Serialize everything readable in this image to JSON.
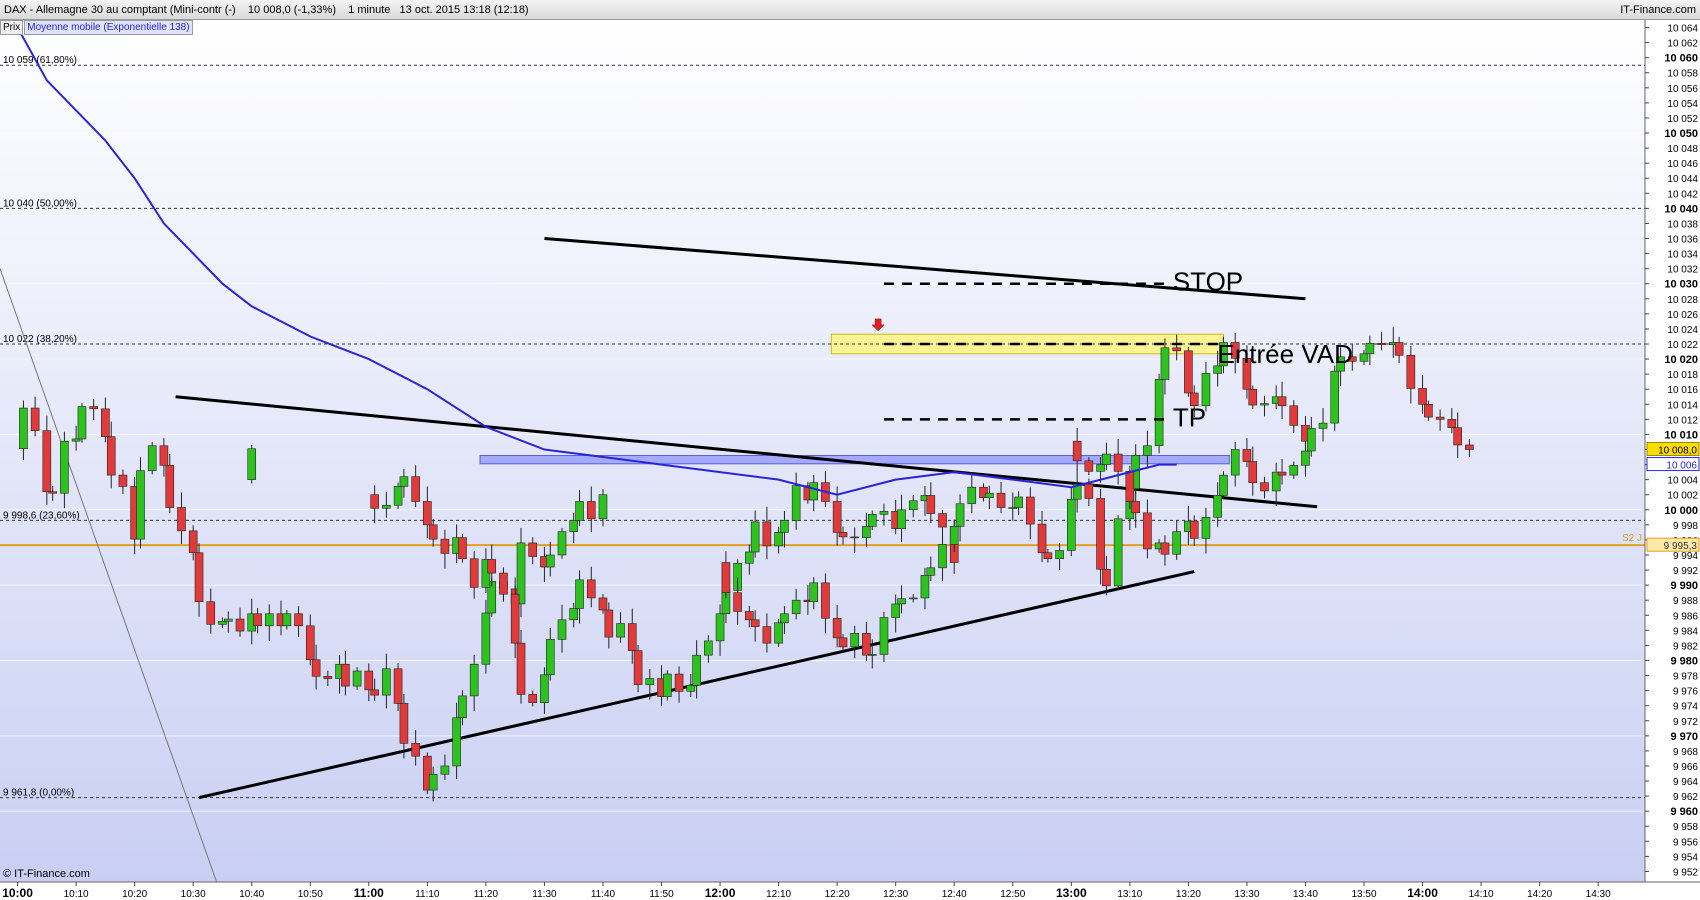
{
  "header": {
    "title": "DAX - Allemagne 30 au comptant (Mini-contr (-)    10 008,0 (-1,33%)    1 minute   13 oct. 2015 13:18 (12:18)",
    "brand": "IT-Finance.com"
  },
  "legend": {
    "price": "Prix",
    "ma": "Moyenne mobile (Exponentielle 138)"
  },
  "watermark": "© IT-Finance.com",
  "colors": {
    "up": "#2ec21f",
    "down": "#e03a3a",
    "ma": "#2b24d6",
    "fib": "#333333",
    "s2": "#e0a020",
    "zone_yellow": "#fff48a",
    "zone_blue": "#9fa4ff"
  },
  "chart_data": {
    "type": "candlestick",
    "ylim": [
      9950.6,
      10065
    ],
    "y_ticks_bold": [
      "10 060",
      "10 050",
      "10 040",
      "10 030",
      "10 020",
      "10 010",
      "10 000",
      "9 990",
      "9 980",
      "9 970",
      "9 960"
    ],
    "y_ticks_minor": [
      "10 064",
      "10 062",
      "10 058",
      "10 056",
      "10 054",
      "10 052",
      "10 048",
      "10 046",
      "10 044",
      "10 042",
      "10 038",
      "10 036",
      "10 034",
      "10 032",
      "10 028",
      "10 026",
      "10 024",
      "10 022",
      "10 018",
      "10 016",
      "10 014",
      "10 012",
      "10 008",
      "10 006",
      "10 004",
      "10 002",
      "9 998",
      "9 996",
      "9 994",
      "9 992",
      "9 988",
      "9 986",
      "9 984",
      "9 982",
      "9 978",
      "9 976",
      "9 974",
      "9 972",
      "9 968",
      "9 966",
      "9 964",
      "9 962",
      "9 958",
      "9 956",
      "9 954",
      "9 952"
    ],
    "x_range": [
      "09:57",
      "14:38"
    ],
    "x_ticks": [
      {
        "t": "10:00",
        "bold": true
      },
      {
        "t": "10:10"
      },
      {
        "t": "10:20"
      },
      {
        "t": "10:30"
      },
      {
        "t": "10:40"
      },
      {
        "t": "10:50"
      },
      {
        "t": "11:00",
        "bold": true
      },
      {
        "t": "11:10"
      },
      {
        "t": "11:20"
      },
      {
        "t": "11:30"
      },
      {
        "t": "11:40"
      },
      {
        "t": "11:50"
      },
      {
        "t": "12:00",
        "bold": true
      },
      {
        "t": "12:10"
      },
      {
        "t": "12:20"
      },
      {
        "t": "12:30"
      },
      {
        "t": "12:40"
      },
      {
        "t": "12:50"
      },
      {
        "t": "13:00",
        "bold": true
      },
      {
        "t": "13:10"
      },
      {
        "t": "13:20"
      },
      {
        "t": "13:30"
      },
      {
        "t": "13:40"
      },
      {
        "t": "13:50"
      },
      {
        "t": "14:00",
        "bold": true
      },
      {
        "t": "14:10"
      },
      {
        "t": "14:20"
      },
      {
        "t": "14:30"
      }
    ],
    "fib_levels": [
      {
        "value": 10059,
        "label": "10 059 (61,80%)"
      },
      {
        "value": 10040,
        "label": "10 040 (50,00%)"
      },
      {
        "value": 10022,
        "label": "10 022 (38,20%)"
      },
      {
        "value": 9998.6,
        "label": "9 998,6 (23,60%)"
      },
      {
        "value": 9961.8,
        "label": "9 961,8 (0,00%)"
      }
    ],
    "s2": {
      "value": 9995.3,
      "label": "S2 J",
      "price_label": "9 995,3"
    },
    "last_price": {
      "value": 10008,
      "label": "10 008,0"
    },
    "ma_last": {
      "value": 10006,
      "label": "10 006"
    },
    "annotations": [
      {
        "text": "STOP",
        "value": 10030,
        "t_start": "12:28",
        "t_end": "13:17"
      },
      {
        "text": "Entrée VAD",
        "value": 10022,
        "t_start": "12:28",
        "t_end": "13:26"
      },
      {
        "text": "TP",
        "value": 10012,
        "t_start": "12:28",
        "t_end": "13:17"
      }
    ],
    "zones": [
      {
        "color": "yellow",
        "t_start": "12:19",
        "t_end": "13:26",
        "y_low": 10020.7,
        "y_high": 10023.3
      },
      {
        "color": "blue",
        "t_start": "11:19",
        "t_end": "13:27",
        "y_low": 10006.1,
        "y_high": 10007.2
      }
    ],
    "trendlines": [
      {
        "t1": "11:30",
        "v1": 10036,
        "t2": "13:40",
        "v2": 10028,
        "width": 3
      },
      {
        "t1": "10:27",
        "v1": 10015,
        "t2": "13:42",
        "v2": 10000.4,
        "width": 3
      },
      {
        "t1": "10:31",
        "v1": 9961.8,
        "t2": "13:21",
        "v2": 9991.8,
        "width": 3
      },
      {
        "t1": "09:57",
        "v1": 10032,
        "t2": "10:34",
        "v2": 9950.6,
        "width": 1
      }
    ],
    "signal_arrow": {
      "t": "12:27",
      "value": 10024
    },
    "ma_points": [
      [
        "10:00",
        10064
      ],
      [
        "10:05",
        10057
      ],
      [
        "10:10",
        10053
      ],
      [
        "10:15",
        10049
      ],
      [
        "10:20",
        10044
      ],
      [
        "10:25",
        10038
      ],
      [
        "10:30",
        10034
      ],
      [
        "10:35",
        10030
      ],
      [
        "10:40",
        10027
      ],
      [
        "10:45",
        10025
      ],
      [
        "10:50",
        10023
      ],
      [
        "11:00",
        10020
      ],
      [
        "11:10",
        10016
      ],
      [
        "11:20",
        10011
      ],
      [
        "11:30",
        10008
      ],
      [
        "11:40",
        10007
      ],
      [
        "11:50",
        10006
      ],
      [
        "12:00",
        10005
      ],
      [
        "12:10",
        10004
      ],
      [
        "12:20",
        10002
      ],
      [
        "12:30",
        10004
      ],
      [
        "12:40",
        10005
      ],
      [
        "12:50",
        10004
      ],
      [
        "13:00",
        10003
      ],
      [
        "13:10",
        10005
      ],
      [
        "13:15",
        10006
      ],
      [
        "13:18",
        10006
      ]
    ],
    "candles": [
      [
        9.996,
        10008.1
      ],
      [
        10.013,
        10013.5
      ],
      [
        10.03,
        10010.5
      ],
      [
        10.047,
        10002.4
      ],
      [
        10.063,
        10002.2
      ],
      [
        10.08,
        10009.1
      ],
      [
        10.097,
        10009.4
      ],
      [
        10.113,
        10013.7
      ],
      [
        10.13,
        10013.4
      ],
      [
        10.147,
        10009.7
      ],
      [
        10.163,
        10004.6
      ],
      [
        10.18,
        10003.1
      ],
      [
        10.197,
        9996.1
      ],
      [
        10.213,
        10005.2
      ],
      [
        10.23,
        10008.5
      ],
      [
        10.247,
        10005.9
      ],
      [
        10.263,
        10000.3
      ],
      [
        10.28,
        9997.2
      ],
      [
        10.297,
        9994.3
      ],
      [
        10.313,
        9987.8
      ],
      [
        10.33,
        9984.8
      ],
      [
        10.347,
        9985.2
      ],
      [
        10.363,
        9985.5
      ],
      [
        10.38,
        9983.9
      ],
      [
        10.397,
        9986.2
      ],
      [
        10.413,
        9984.6
      ],
      [
        10.43,
        9986.2
      ],
      [
        10.447,
        9984.6
      ],
      [
        10.463,
        9986.2
      ],
      [
        10.48,
        9984.6
      ],
      [
        10.497,
        9980.1
      ],
      [
        10.513,
        9977.9
      ],
      [
        10.53,
        9977.6
      ],
      [
        10.547,
        9979.5
      ],
      [
        10.563,
        9976.6
      ],
      [
        10.58,
        9978.6
      ],
      [
        10.597,
        9976.1
      ],
      [
        10.613,
        9975.4
      ],
      [
        10.63,
        9978.9
      ],
      [
        10.647,
        9974.3
      ],
      [
        10.663,
        9969.0
      ],
      [
        10.68,
        9967.3
      ],
      [
        10.697,
        9962.8
      ],
      [
        10.713,
        9964.9
      ],
      [
        10.73,
        9966.0
      ],
      [
        10.747,
        9972.4
      ],
      [
        10.763,
        9975.3
      ],
      [
        10.78,
        9979.5
      ],
      [
        10.797,
        9986.3
      ],
      [
        10.813,
        9990.5
      ],
      [
        10.83,
        9989.5
      ],
      [
        10.847,
        9987.5
      ],
      [
        10.863,
        9995.6
      ],
      [
        10.88,
        9993.8
      ],
      [
        10.897,
        9992.4
      ],
      [
        10.913,
        9994.0
      ],
      [
        10.93,
        9997.1
      ],
      [
        10.947,
        9998.6
      ],
      [
        10.963,
        10001.1
      ],
      [
        10.98,
        9998.8
      ],
      [
        10.997,
        10002.0
      ],
      [
        11.013,
        10000.2
      ],
      [
        11.03,
        10000.6
      ],
      [
        11.047,
        10003.1
      ],
      [
        11.063,
        10004.4
      ],
      [
        11.08,
        10001.1
      ],
      [
        11.097,
        9998.0
      ],
      [
        11.113,
        9996.1
      ],
      [
        11.13,
        9994.2
      ],
      [
        11.147,
        9996.3
      ],
      [
        11.163,
        9993.5
      ],
      [
        11.18,
        9989.7
      ],
      [
        11.197,
        9993.4
      ],
      [
        11.213,
        9991.6
      ],
      [
        11.23,
        9988.8
      ],
      [
        11.247,
        9982.3
      ],
      [
        11.263,
        9975.5
      ],
      [
        11.28,
        9974.4
      ],
      [
        11.297,
        9978.1
      ],
      [
        11.313,
        9982.8
      ],
      [
        11.33,
        9985.4
      ],
      [
        11.347,
        9986.9
      ],
      [
        11.363,
        9990.7
      ],
      [
        11.38,
        9988.3
      ],
      [
        11.397,
        9986.7
      ],
      [
        11.413,
        9983.1
      ],
      [
        11.43,
        9984.9
      ],
      [
        11.447,
        9981.3
      ],
      [
        11.463,
        9976.8
      ],
      [
        11.48,
        9977.6
      ],
      [
        11.497,
        9975.2
      ],
      [
        11.513,
        9978.2
      ],
      [
        11.53,
        9975.9
      ],
      [
        11.547,
        9976.7
      ],
      [
        11.563,
        9980.7
      ],
      [
        11.58,
        9982.6
      ],
      [
        11.597,
        9986.2
      ],
      [
        11.613,
        9989.3
      ],
      [
        11.63,
        9992.9
      ],
      [
        11.647,
        9994.4
      ],
      [
        11.663,
        9998.4
      ],
      [
        11.68,
        9995.2
      ],
      [
        11.697,
        9997.0
      ],
      [
        11.713,
        9998.6
      ],
      [
        11.73,
        10003.2
      ],
      [
        11.747,
        10001.3
      ],
      [
        11.763,
        10003.6
      ],
      [
        11.78,
        10001.1
      ],
      [
        11.797,
        9997.0
      ],
      [
        11.813,
        9996.4
      ],
      [
        11.83,
        9996.3
      ],
      [
        11.847,
        9997.8
      ],
      [
        11.863,
        9999.4
      ],
      [
        11.88,
        9999.8
      ],
      [
        11.897,
        9997.5
      ],
      [
        11.913,
        10000.0
      ],
      [
        11.93,
        10001.2
      ],
      [
        11.947,
        10001.9
      ],
      [
        11.963,
        9999.5
      ],
      [
        11.98,
        9997.7
      ],
      [
        11.997,
        9993.0
      ],
      [
        12.013,
        9989.0
      ],
      [
        12.03,
        9986.5
      ],
      [
        12.047,
        9985.4
      ],
      [
        12.063,
        9984.5
      ],
      [
        12.08,
        9982.3
      ],
      [
        12.097,
        9985.0
      ],
      [
        12.113,
        9986.2
      ],
      [
        12.13,
        9988.0
      ],
      [
        12.147,
        9987.8
      ],
      [
        12.163,
        9990.3
      ],
      [
        12.18,
        9985.6
      ],
      [
        12.197,
        9983.0
      ],
      [
        12.213,
        9981.8
      ],
      [
        12.23,
        9983.6
      ],
      [
        12.247,
        9980.7
      ],
      [
        12.263,
        9980.8
      ],
      [
        12.28,
        9985.7
      ],
      [
        12.297,
        9987.5
      ],
      [
        12.313,
        9988.2
      ],
      [
        12.33,
        9988.3
      ],
      [
        12.347,
        9991.3
      ],
      [
        12.363,
        9992.3
      ],
      [
        12.38,
        9995.4
      ],
      [
        12.397,
        9997.8
      ],
      [
        12.413,
        10000.8
      ],
      [
        12.43,
        10003.0
      ],
      [
        12.447,
        10001.6
      ],
      [
        12.463,
        10002.2
      ],
      [
        12.48,
        10000.3
      ],
      [
        12.497,
        10000.3
      ],
      [
        12.513,
        10001.7
      ],
      [
        12.53,
        9998.1
      ],
      [
        12.547,
        9994.3
      ],
      [
        12.563,
        9993.5
      ],
      [
        12.58,
        9994.6
      ],
      [
        12.597,
        10001.4
      ],
      [
        12.613,
        10003.4
      ],
      [
        12.63,
        10001.5
      ],
      [
        12.647,
        9992.1
      ],
      [
        12.663,
        9989.9
      ],
      [
        12.68,
        9998.8
      ],
      [
        12.697,
        10002.8
      ],
      [
        12.713,
        10007.2
      ],
      [
        12.73,
        10008.5
      ],
      [
        12.747,
        10017.3
      ],
      [
        12.763,
        10021.5
      ],
      [
        12.78,
        10021.1
      ],
      [
        12.797,
        10015.5
      ],
      [
        12.813,
        10013.8
      ],
      [
        12.83,
        10018.1
      ],
      [
        12.847,
        10019.1
      ],
      [
        12.863,
        10022.2
      ],
      [
        12.88,
        10020.1
      ],
      [
        12.897,
        10016.0
      ],
      [
        12.913,
        10013.9
      ],
      [
        12.93,
        10014.1
      ],
      [
        12.947,
        10015.0
      ],
      [
        12.963,
        10013.8
      ],
      [
        12.98,
        10011.2
      ],
      [
        12.997,
        10009.1
      ],
      [
        13.013,
        10006.5
      ],
      [
        13.03,
        10005.1
      ],
      [
        13.047,
        10006.0
      ],
      [
        13.063,
        10007.4
      ],
      [
        13.08,
        10005.1
      ],
      [
        13.097,
        10001.1
      ],
      [
        13.113,
        9999.6
      ],
      [
        13.13,
        9994.8
      ],
      [
        13.147,
        9995.6
      ],
      [
        13.163,
        9994.1
      ],
      [
        13.18,
        9997.1
      ],
      [
        13.197,
        9998.5
      ],
      [
        13.213,
        9996.2
      ],
      [
        13.23,
        9999.0
      ],
      [
        13.247,
        10001.9
      ],
      [
        13.263,
        10004.6
      ],
      [
        13.28,
        10008.0
      ],
      [
        13.297,
        10006.4
      ],
      [
        13.313,
        10003.6
      ],
      [
        13.33,
        10002.5
      ],
      [
        13.347,
        10005.0
      ],
      [
        13.363,
        10004.6
      ],
      [
        13.38,
        10005.9
      ],
      [
        13.397,
        10007.8
      ],
      [
        13.413,
        10010.8
      ],
      [
        13.43,
        10011.5
      ],
      [
        13.447,
        10018.4
      ],
      [
        13.463,
        10020.3
      ],
      [
        13.48,
        10019.7
      ],
      [
        13.497,
        10020.7
      ],
      [
        13.513,
        10022.1
      ],
      [
        13.53,
        10021.9
      ],
      [
        13.547,
        10022.2
      ],
      [
        13.563,
        10020.5
      ],
      [
        13.58,
        10016.1
      ],
      [
        13.597,
        10014.0
      ],
      [
        13.613,
        10012.3
      ],
      [
        13.63,
        10012.0
      ],
      [
        13.647,
        10010.9
      ],
      [
        13.663,
        10008.6
      ],
      [
        13.68,
        10008.0
      ]
    ]
  }
}
